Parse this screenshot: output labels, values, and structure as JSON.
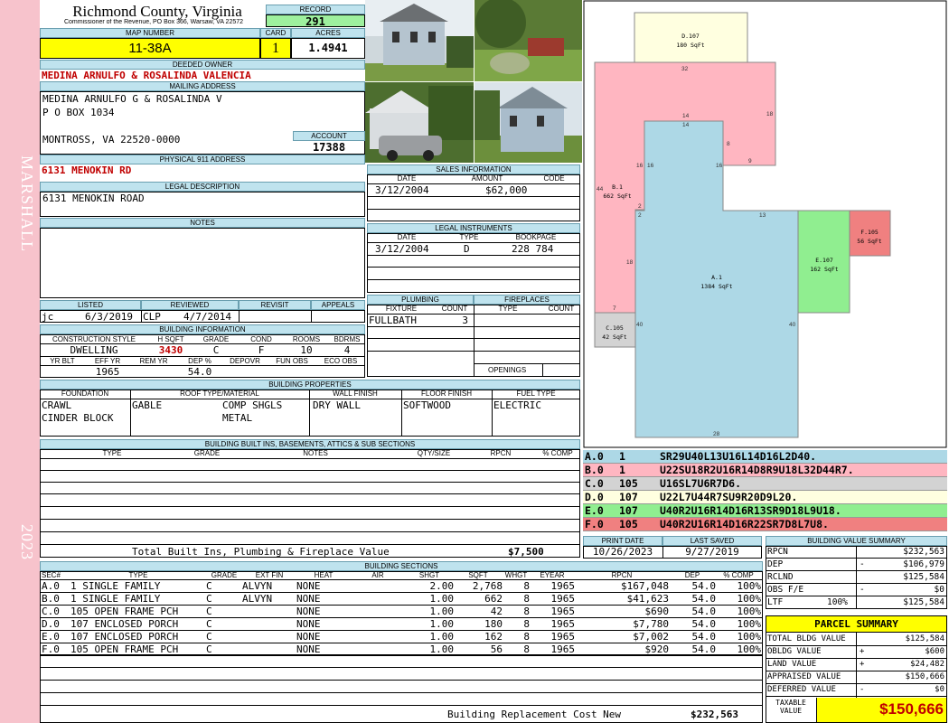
{
  "sidebar": {
    "district": "MARSHALL",
    "year": "2023"
  },
  "header": {
    "county": "Richmond County, Virginia",
    "office": "Commissioner of the Revenue, PO Box 366, Warsaw, VA 22572",
    "record_label": "RECORD",
    "record": "291",
    "map_number_label": "MAP NUMBER",
    "map_number": "11-38A",
    "card_label": "CARD",
    "card": "1",
    "acres_label": "ACRES",
    "acres": "1.4941"
  },
  "owner": {
    "deeded_label": "DEEDED OWNER",
    "deeded": "MEDINA ARNULFO & ROSALINDA VALENCIA",
    "mailing_label": "MAILING ADDRESS",
    "mail_line1": "MEDINA ARNULFO G & ROSALINDA V",
    "mail_line2": "P O BOX 1034",
    "mail_line3": "MONTROSS, VA 22520-0000",
    "account_label": "ACCOUNT",
    "account": "17388",
    "address_label": "PHYSICAL 911 ADDRESS",
    "address": "6131 MENOKIN RD",
    "legal_label": "LEGAL DESCRIPTION",
    "legal": "6131 MENOKIN ROAD",
    "notes_label": "NOTES"
  },
  "sales": {
    "title": "SALES INFORMATION",
    "col_date": "DATE",
    "col_amount": "AMOUNT",
    "col_code": "CODE",
    "date": "3/12/2004",
    "amount": "$62,000",
    "code": ""
  },
  "legal_instruments": {
    "title": "LEGAL INSTRUMENTS",
    "col_date": "DATE",
    "col_type": "TYPE",
    "col_book": "BOOKPAGE",
    "date": "3/12/2004",
    "type": "D",
    "book": "228 784"
  },
  "listing": {
    "listed_label": "LISTED",
    "reviewed_label": "REVIEWED",
    "revisit_label": "REVISIT",
    "appeals_label": "APPEALS",
    "listed_by": "jc",
    "listed_date": "6/3/2019",
    "reviewed_by": "CLP",
    "reviewed_date": "4/7/2014"
  },
  "building_info": {
    "title": "BUILDING INFORMATION",
    "h_style": "CONSTRUCTION STYLE",
    "h_hsqft": "H SQFT",
    "h_grade": "GRADE",
    "h_cond": "COND",
    "h_rooms": "ROOMS",
    "h_bdrms": "BDRMS",
    "style": "DWELLING",
    "hsqft": "3430",
    "grade": "C",
    "cond": "F",
    "rooms": "10",
    "bdrms": "4",
    "h_yrblt": "YR BLT",
    "h_effyr": "EFF YR",
    "h_remyr": "REM YR",
    "h_dep": "DEP %",
    "h_depovr": "DEPOVR",
    "h_funobs": "FUN OBS",
    "h_ecoobs": "ECO OBS",
    "effyr": "1965",
    "dep": "54.0"
  },
  "plumbing": {
    "title": "PLUMBING",
    "col_fixture": "FIXTURE",
    "col_count": "COUNT",
    "fixture": "FULLBATH",
    "count": "3"
  },
  "fireplaces": {
    "title": "FIREPLACES",
    "col_type": "TYPE",
    "col_count": "COUNT",
    "openings": "OPENINGS"
  },
  "properties": {
    "title": "BUILDING PROPERTIES",
    "h_foundation": "FOUNDATION",
    "h_roof": "ROOF TYPE/MATERIAL",
    "h_wall": "WALL FINISH",
    "h_floor": "FLOOR FINISH",
    "h_fuel": "FUEL TYPE",
    "foundation1": "CRAWL",
    "foundation2": "CINDER BLOCK",
    "roof_type": "GABLE",
    "roof_mat1": "COMP SHGLS",
    "roof_mat2": "METAL",
    "wall": "DRY WALL",
    "floor": "SOFTWOOD",
    "fuel": "ELECTRIC"
  },
  "builtins": {
    "title": "BUILDING BUILT INS, BASEMENTS, ATTICS & SUB SECTIONS",
    "h_type": "TYPE",
    "h_grade": "GRADE",
    "h_notes": "NOTES",
    "h_qty": "QTY/SIZE",
    "h_rpcn": "RPCN",
    "h_comp": "% COMP",
    "total_label": "Total Built Ins, Plumbing & Fireplace Value",
    "total": "$7,500"
  },
  "print_info": {
    "print_label": "PRINT DATE",
    "saved_label": "LAST SAVED",
    "print_date": "10/26/2023",
    "saved_date": "9/27/2019"
  },
  "sections": {
    "title": "BUILDING SECTIONS",
    "headers": [
      "SEC#",
      "TYPE",
      "GRADE",
      "EXT FIN",
      "HEAT",
      "AIR",
      "SHGT",
      "SQFT",
      "WHGT",
      "EYEAR",
      "RPCN",
      "DEP",
      "% COMP"
    ],
    "rows": [
      [
        "A.0",
        "1 SINGLE FAMILY",
        "C",
        "ALVYN",
        "NONE",
        "",
        "2.00",
        "2,768",
        "8",
        "1965",
        "$167,048",
        "54.0",
        "100%"
      ],
      [
        "B.0",
        "1 SINGLE FAMILY",
        "C",
        "ALVYN",
        "NONE",
        "",
        "1.00",
        "662",
        "8",
        "1965",
        "$41,623",
        "54.0",
        "100%"
      ],
      [
        "C.0",
        "105 OPEN FRAME PCH",
        "C",
        "",
        "NONE",
        "",
        "1.00",
        "42",
        "8",
        "1965",
        "$690",
        "54.0",
        "100%"
      ],
      [
        "D.0",
        "107 ENCLOSED PORCH",
        "C",
        "",
        "NONE",
        "",
        "1.00",
        "180",
        "8",
        "1965",
        "$7,780",
        "54.0",
        "100%"
      ],
      [
        "E.0",
        "107 ENCLOSED PORCH",
        "C",
        "",
        "NONE",
        "",
        "1.00",
        "162",
        "8",
        "1965",
        "$7,002",
        "54.0",
        "100%"
      ],
      [
        "F.0",
        "105 OPEN FRAME PCH",
        "C",
        "",
        "NONE",
        "",
        "1.00",
        "56",
        "8",
        "1965",
        "$920",
        "54.0",
        "100%"
      ]
    ],
    "replacement_label": "Building Replacement Cost New",
    "replacement": "$232,563"
  },
  "sketch": {
    "areas": [
      {
        "label": "A.1",
        "sqft": "1384 SqFt",
        "color": "#add8e6"
      },
      {
        "label": "B.1",
        "sqft": "662 SqFt",
        "color": "#ffb6c1"
      },
      {
        "label": "C.105",
        "sqft": "42 SqFt",
        "color": "#d3d3d3"
      },
      {
        "label": "D.107",
        "sqft": "180 SqFt",
        "color": "#ffffe0"
      },
      {
        "label": "E.107",
        "sqft": "162 SqFt",
        "color": "#90ee90"
      },
      {
        "label": "F.105",
        "sqft": "56 SqFt",
        "color": "#f08080"
      }
    ],
    "dims": [
      "32",
      "18",
      "14",
      "14",
      "8",
      "9",
      "16",
      "16",
      "16",
      "2",
      "2",
      "13",
      "18",
      "7",
      "40",
      "40",
      "28",
      "44"
    ],
    "vectors": [
      {
        "sec": "A.0",
        "code": "1",
        "vector": "SR29U40L13U16L14D16L2D40.",
        "color": "#add8e6"
      },
      {
        "sec": "B.0",
        "code": "1",
        "vector": "U22SU18R2U16R14D8R9U18L32D44R7.",
        "color": "#ffb6c1"
      },
      {
        "sec": "C.0",
        "code": "105",
        "vector": "U16SL7U6R7D6.",
        "color": "#d3d3d3"
      },
      {
        "sec": "D.0",
        "code": "107",
        "vector": "U22L7U44R7SU9R20D9L20.",
        "color": "#ffffe0"
      },
      {
        "sec": "E.0",
        "code": "107",
        "vector": "U40R2U16R14D16R13SR9D18L9U18.",
        "color": "#90ee90"
      },
      {
        "sec": "F.0",
        "code": "105",
        "vector": "U40R2U16R14D16R22SR7D8L7U8.",
        "color": "#f08080"
      }
    ]
  },
  "building_value": {
    "title": "BUILDING VALUE SUMMARY",
    "rpcn_label": "RPCN",
    "rpcn": "$232,563",
    "dep_label": "DEP",
    "dep_sign": "-",
    "dep": "$106,979",
    "rclnd_label": "RCLND",
    "rclnd": "$125,584",
    "obs_label": "OBS F/E",
    "obs_sign": "-",
    "obs": "$0",
    "ltf_label": "LTF",
    "ltf_pct": "100%",
    "ltf": "$125,584"
  },
  "parcel_summary": {
    "title": "PARCEL SUMMARY",
    "total_bldg_label": "TOTAL BLDG VALUE",
    "total_bldg": "$125,584",
    "obldg_label": "OBLDG VALUE",
    "obldg_sign": "+",
    "obldg": "$600",
    "land_label": "LAND VALUE",
    "land_sign": "+",
    "land": "$24,482",
    "appraised_label": "APPRAISED VALUE",
    "appraised": "$150,666",
    "deferred_label": "DEFERRED VALUE",
    "deferred_sign": "-",
    "deferred": "$0",
    "taxable_label1": "TAXABLE",
    "taxable_label2": "VALUE",
    "taxable": "$150,666"
  },
  "colors": {
    "highlight_yellow": "#ffff00",
    "record_green": "#9ef09e",
    "header_blue": "#bfe3ee",
    "sidebar_pink": "#f7c3cc",
    "value_red": "#c00000"
  }
}
